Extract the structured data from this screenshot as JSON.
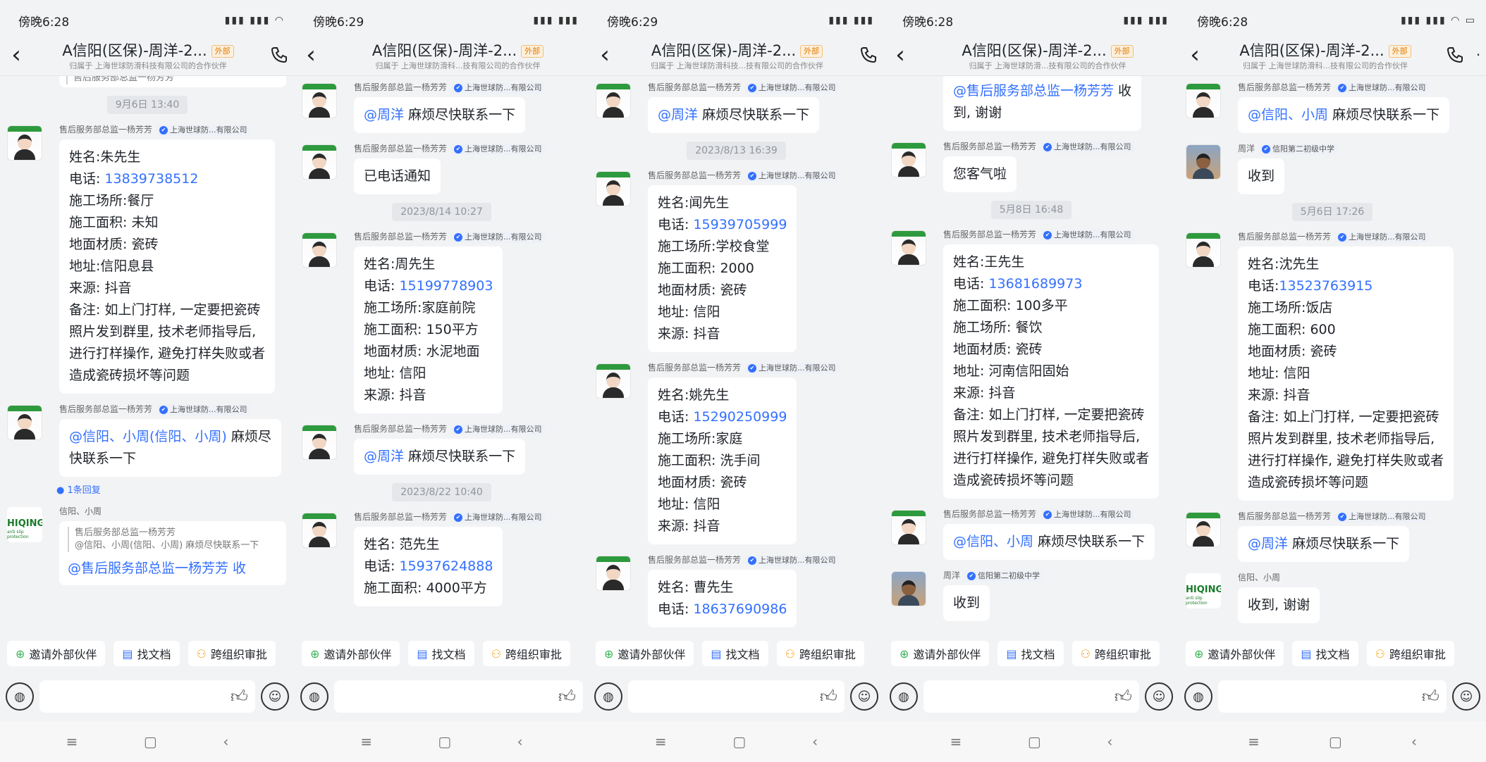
{
  "common": {
    "title": "A信阳(区保)-周洋-2...",
    "ext_tag": "外部",
    "subtitle_a": "归属于 上海世球防滑科技有限公司的合作伙伴",
    "tools": [
      "邀请外部伙伴",
      "找文档",
      "跨组织审批"
    ],
    "sender": "售后服务部总监一杨芳芳",
    "company": "上海世球防...有限公司",
    "ask_zy": "麻烦尽快联系一下",
    "at_zy": "@周洋",
    "nav": [
      "≡",
      "▢",
      "‹"
    ]
  },
  "panels": [
    {
      "time": "傍晚6:28",
      "subtitle": "归属于 上海世球防滑科技有限公司的合作伙伴",
      "top_partial": "售后服务部总监一杨芳芳",
      "ts1": "9月6日 13:40",
      "order_lines": [
        "姓名:朱先生",
        "电话: ",
        "施工场所:餐厅",
        "施工面积: 未知",
        "地面材质: 瓷砖",
        "地址:信阳息县",
        "来源: 抖音",
        "备注: 如上门打样, 一定要把瓷砖",
        "照片发到群里, 技术老师指导后,",
        "进行打样操作, 避免打样失败或者",
        "造成瓷砖损坏等问题"
      ],
      "phone": "13839738512",
      "at_msg": "@信阳、小周(信阳、小周)",
      "at_rest": " 麻烦尽",
      "at_rest2": "快联系一下",
      "reply": "1条回复",
      "xy_name": "信阳、小周",
      "logo": "HIQING",
      "logo_sub": "anti slip protection",
      "quote_head": "售后服务部总监一杨芳芳",
      "quote_body": "@信阳、小周(信阳、小周) 麻烦尽快联系一下",
      "bottom_partial": "@售后服务部总监一杨芳芳 收"
    },
    {
      "time": "傍晚6:29",
      "subtitle": "归属于 上海世球防滑科...技有限公司的合作伙伴",
      "msg_notify": "已电话通知",
      "ts1": "2023/8/14 10:27",
      "order1": [
        "姓名:周先生",
        "电话: ",
        "施工场所:家庭前院",
        "施工面积: 150平方",
        "地面材质: 水泥地面",
        "地址: 信阳",
        "来源: 抖音"
      ],
      "phone1": "15199778903",
      "ts2": "2023/8/22 10:40",
      "order2": [
        "姓名: 范先生",
        "电话: ",
        "施工面积: 4000平方"
      ],
      "phone2": "15937624888"
    },
    {
      "time": "傍晚6:29",
      "subtitle": "归属于 上海世球防滑科技...技有限公司的合作伙伴",
      "ts1": "2023/8/13 16:39",
      "order1": [
        "姓名:闻先生",
        "电话: ",
        "施工场所:学校食堂",
        "施工面积: 2000",
        "地面材质: 瓷砖",
        "地址: 信阳",
        "来源: 抖音"
      ],
      "phone1": "15939705999",
      "order2": [
        "姓名:姚先生",
        "电话: ",
        "施工场所:家庭",
        "施工面积: 洗手间",
        "地面材质: 瓷砖",
        "地址: 信阳",
        "来源: 抖音"
      ],
      "phone2": "15290250999",
      "order3": [
        "姓名: 曹先生",
        "电话: "
      ],
      "phone3": "18637690986"
    },
    {
      "time": "傍晚6:28",
      "subtitle": "归属于 上海世球防滑...技有限公司的合作伙伴",
      "top_msg": "@售后服务部总监一杨芳芳",
      "top_rest": " 收",
      "top_rest2": "到, 谢谢",
      "welcome": "您客气啦",
      "ts1": "5月8日 16:48",
      "order_lines": [
        "姓名:王先生",
        "电话: ",
        "施工面积: 100多平",
        "施工场所: 餐饮",
        "地面材质: 瓷砖",
        "地址: 河南信阳固始",
        "来源: 抖音",
        "备注: 如上门打样, 一定要把瓷砖",
        "照片发到群里, 技术老师指导后,",
        "进行打样操作, 避免打样失败或者",
        "造成瓷砖损坏等问题"
      ],
      "phone": "13681689973",
      "at_msg": "@信阳、小周",
      "zy_name": "周洋",
      "zy_company": "信阳第二初级中学",
      "received": "收到"
    },
    {
      "time": "傍晚6:28",
      "subtitle": "归属于 上海世球防滑科...技有限公司的合作伙伴",
      "at_msg": "@信阳、小周",
      "zy_name": "周洋",
      "zy_company": "信阳第二初级中学",
      "received": "收到",
      "ts1": "5月6日 17:26",
      "order_lines": [
        "姓名:沈先生",
        "电话:",
        "施工场所:饭店",
        "施工面积: 600",
        "地面材质: 瓷砖",
        "地址: 信阳",
        "来源: 抖音",
        "备注: 如上门打样, 一定要把瓷砖",
        "照片发到群里, 技术老师指导后,",
        "进行打样操作, 避免打样失败或者",
        "造成瓷砖损坏等问题"
      ],
      "phone": "13523763915",
      "xy_name": "信阳、小周",
      "logo": "HIQING",
      "logo_sub": "anti slip protection",
      "last_msg": "收到, 谢谢"
    }
  ]
}
